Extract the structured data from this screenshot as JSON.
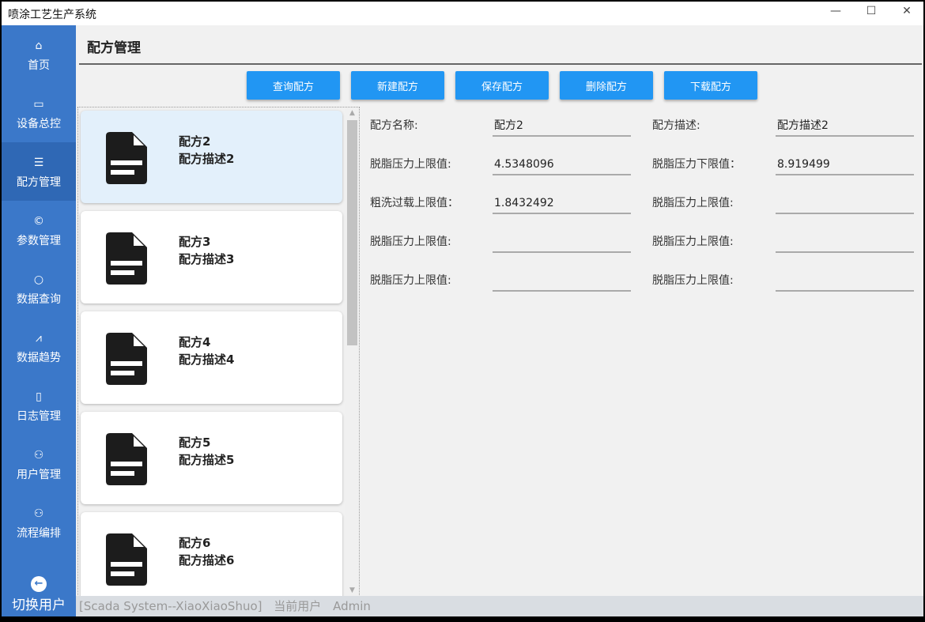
{
  "window": {
    "title": "喷涂工艺生产系统",
    "minimize": "—",
    "maximize": "☐",
    "close": "✕"
  },
  "sidebar": {
    "items": [
      {
        "label": "首页",
        "icon": "⌂"
      },
      {
        "label": "设备总控",
        "icon": "▭"
      },
      {
        "label": "配方管理",
        "icon": "☰"
      },
      {
        "label": "参数管理",
        "icon": "©"
      },
      {
        "label": "数据查询",
        "icon": "○"
      },
      {
        "label": "数据趋势",
        "icon": "⩘"
      },
      {
        "label": "日志管理",
        "icon": "▯"
      },
      {
        "label": "用户管理",
        "icon": "⚇"
      },
      {
        "label": "流程编排",
        "icon": "⚇"
      }
    ],
    "active": "配方管理",
    "switch_user": {
      "label": "切换用户",
      "icon": "←"
    }
  },
  "page": {
    "title": "配方管理"
  },
  "toolbar": {
    "buttons": [
      "查询配方",
      "新建配方",
      "保存配方",
      "删除配方",
      "下载配方"
    ]
  },
  "recipes": [
    {
      "name": "配方2",
      "desc": "配方描述2"
    },
    {
      "name": "配方3",
      "desc": "配方描述3"
    },
    {
      "name": "配方4",
      "desc": "配方描述4"
    },
    {
      "name": "配方5",
      "desc": "配方描述5"
    },
    {
      "name": "配方6",
      "desc": "配方描述6"
    }
  ],
  "form": {
    "fields": [
      {
        "label": "配方名称:",
        "value": "配方2"
      },
      {
        "label": "配方描述:",
        "value": "配方描述2"
      },
      {
        "label": "脱脂压力上限值:",
        "value": "4.5348096"
      },
      {
        "label": "脱脂压力下限值：",
        "value": "8.919499"
      },
      {
        "label": "粗洗过载上限值：",
        "value": "1.8432492"
      },
      {
        "label": "脱脂压力上限值:",
        "value": ""
      },
      {
        "label": "脱脂压力上限值:",
        "value": ""
      },
      {
        "label": "脱脂压力上限值:",
        "value": ""
      },
      {
        "label": "脱脂压力上限值:",
        "value": ""
      },
      {
        "label": "脱脂压力上限值:",
        "value": ""
      }
    ]
  },
  "status": {
    "system": "[Scada System--XiaoXiaoShuo]",
    "user_label": "当前用户",
    "user": "Admin"
  }
}
